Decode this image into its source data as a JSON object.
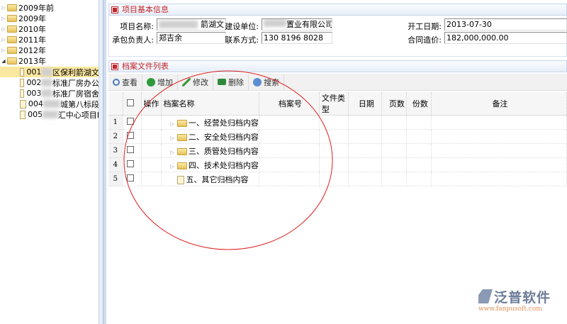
{
  "tree": [
    {
      "label": "2009年前",
      "type": "folder",
      "expanded": false
    },
    {
      "label": "2009年",
      "type": "folder",
      "expanded": false
    },
    {
      "label": "2010年",
      "type": "folder",
      "expanded": false
    },
    {
      "label": "2011年",
      "type": "folder",
      "expanded": false
    },
    {
      "label": "2012年",
      "type": "folder",
      "expanded": false
    },
    {
      "label": "2013年",
      "type": "folder",
      "expanded": true
    },
    {
      "code": "001",
      "label": "区保利箭湖文",
      "type": "doc",
      "selected": true
    },
    {
      "code": "002",
      "label": "标准厂房办公",
      "type": "doc"
    },
    {
      "code": "003",
      "label": "标准厂房宿舍",
      "type": "doc"
    },
    {
      "code": "004",
      "label": "城第八标段",
      "type": "doc"
    },
    {
      "code": "005",
      "label": "汇中心项目I",
      "type": "doc"
    }
  ],
  "info": {
    "title": "项目基本信息",
    "project_name_label": "项目名称:",
    "project_name": "箭湖文",
    "builder_label": "建设单位:",
    "builder": "置业有限公司",
    "start_label": "开工日期:",
    "start": "2013-07-30",
    "manager_label": "承包负责人:",
    "manager": "郑吉余",
    "contact_label": "联系方式:",
    "contact": "130 8196 8028",
    "price_label": "合同造价:",
    "price": "182,000,000.00"
  },
  "archive": {
    "title": "档案文件列表",
    "toolbar": [
      "查看",
      "增加",
      "修改",
      "删除",
      "搜索"
    ],
    "columns": [
      "操作",
      "档案名称",
      "档案号",
      "文件类型",
      "日期",
      "页数",
      "份数",
      "备注"
    ],
    "rows": [
      {
        "n": "1",
        "name": "一、经营处归档内容",
        "type": "folder"
      },
      {
        "n": "2",
        "name": "二、安全处归档内容",
        "type": "folder"
      },
      {
        "n": "3",
        "name": "三、质管处归档内容",
        "type": "folder"
      },
      {
        "n": "4",
        "name": "四、技术处归档内容",
        "type": "folder"
      },
      {
        "n": "5",
        "name": "五、其它归档内容",
        "type": "doc"
      }
    ]
  },
  "logo": {
    "name": "泛普软件",
    "url": "www.fanpusoft.com"
  },
  "colors": {
    "accent": "#c0242a",
    "annotation": "#e02020"
  }
}
